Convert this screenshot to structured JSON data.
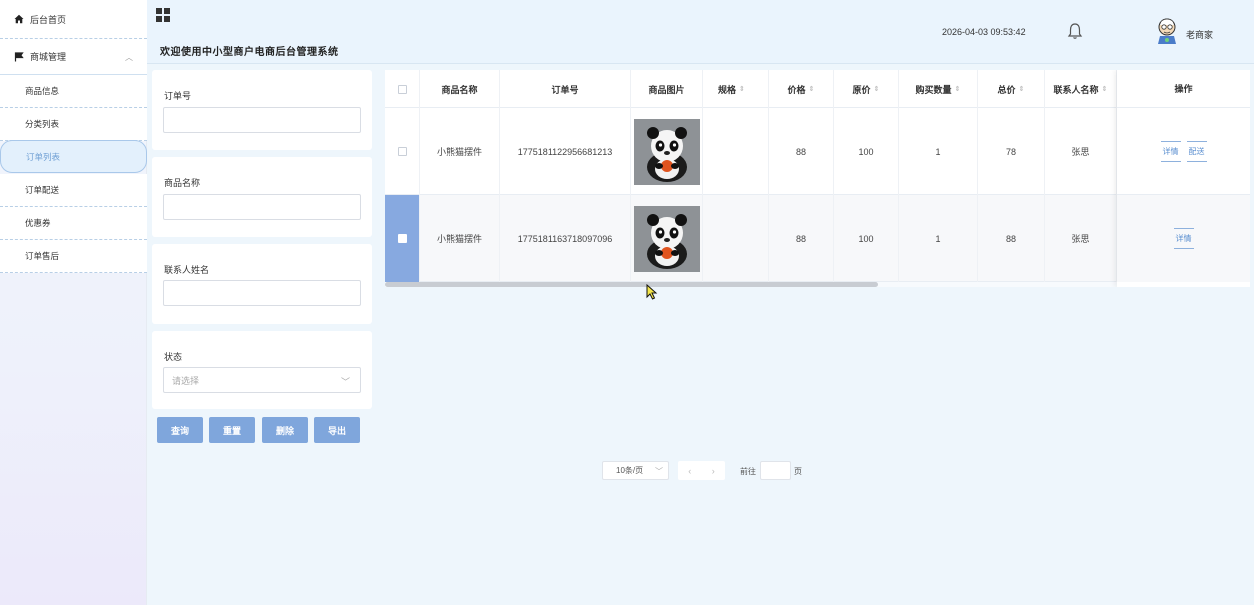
{
  "sidebar": {
    "home": "后台首页",
    "mall": "商城管理",
    "items": [
      {
        "label": "商品信息"
      },
      {
        "label": "分类列表"
      },
      {
        "label": "订单列表"
      },
      {
        "label": "订单配送"
      },
      {
        "label": "优惠券"
      },
      {
        "label": "订单售后"
      }
    ]
  },
  "header": {
    "title": "欢迎使用中小型商户电商后台管理系统",
    "datetime": "2026-04-03 09:53:42",
    "username": "老商家"
  },
  "filters": {
    "order_no_label": "订单号",
    "product_name_label": "商品名称",
    "contact_label": "联系人姓名",
    "status_label": "状态",
    "status_placeholder": "请选择"
  },
  "buttons": {
    "query": "查询",
    "reset": "重置",
    "delete": "删除",
    "export": "导出"
  },
  "table": {
    "headers": {
      "name": "商品名称",
      "order_no": "订单号",
      "image": "商品图片",
      "spec": "规格",
      "price": "价格",
      "original": "原价",
      "qty": "购买数量",
      "total": "总价",
      "contact": "联系人名称",
      "ops": "操作"
    },
    "rows": [
      {
        "name": "小熊猫摆件",
        "order_no": "1775181122956681213",
        "spec": "",
        "price": "88",
        "original": "100",
        "qty": "1",
        "total": "78",
        "contact": "张思",
        "ops": [
          "详情",
          "配送"
        ],
        "selected": false
      },
      {
        "name": "小熊猫摆件",
        "order_no": "1775181163718097096",
        "spec": "",
        "price": "88",
        "original": "100",
        "qty": "1",
        "total": "88",
        "contact": "张思",
        "ops": [
          "详情"
        ],
        "selected": true
      }
    ]
  },
  "pager": {
    "page_size": "10条/页",
    "goto": "前往",
    "page_unit": "页"
  }
}
